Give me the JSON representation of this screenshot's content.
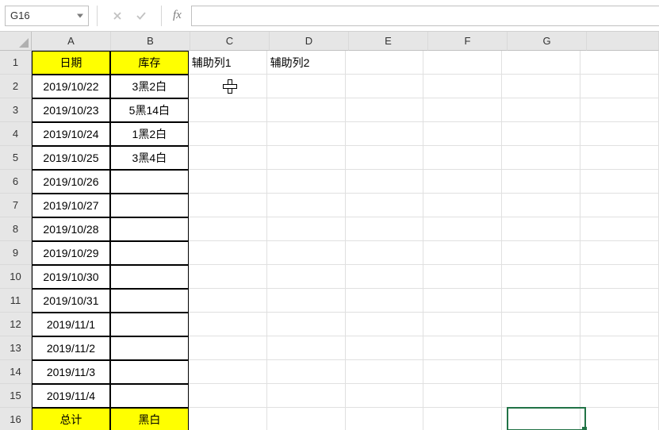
{
  "name_box": {
    "value": "G16"
  },
  "formula_input": {
    "value": ""
  },
  "col_headers": [
    "A",
    "B",
    "C",
    "D",
    "E",
    "F",
    "G"
  ],
  "row_headers": [
    "1",
    "2",
    "3",
    "4",
    "5",
    "6",
    "7",
    "8",
    "9",
    "10",
    "11",
    "12",
    "13",
    "14",
    "15",
    "16"
  ],
  "header_row": {
    "A": "日期",
    "B": "库存"
  },
  "aux_headers": {
    "C": "辅助列1",
    "D": "辅助列2"
  },
  "data_rows": [
    {
      "A": "2019/10/22",
      "B": "3黑2白"
    },
    {
      "A": "2019/10/23",
      "B": "5黑14白"
    },
    {
      "A": "2019/10/24",
      "B": "1黑2白"
    },
    {
      "A": "2019/10/25",
      "B": "3黑4白"
    },
    {
      "A": "2019/10/26",
      "B": ""
    },
    {
      "A": "2019/10/27",
      "B": ""
    },
    {
      "A": "2019/10/28",
      "B": ""
    },
    {
      "A": "2019/10/29",
      "B": ""
    },
    {
      "A": "2019/10/30",
      "B": ""
    },
    {
      "A": "2019/10/31",
      "B": ""
    },
    {
      "A": "2019/11/1",
      "B": ""
    },
    {
      "A": "2019/11/2",
      "B": ""
    },
    {
      "A": "2019/11/3",
      "B": ""
    },
    {
      "A": "2019/11/4",
      "B": ""
    }
  ],
  "total_row": {
    "A": "总计",
    "B": "黑白"
  },
  "fx_label": "fx",
  "selection": {
    "col_index": 6,
    "row_index": 15
  }
}
